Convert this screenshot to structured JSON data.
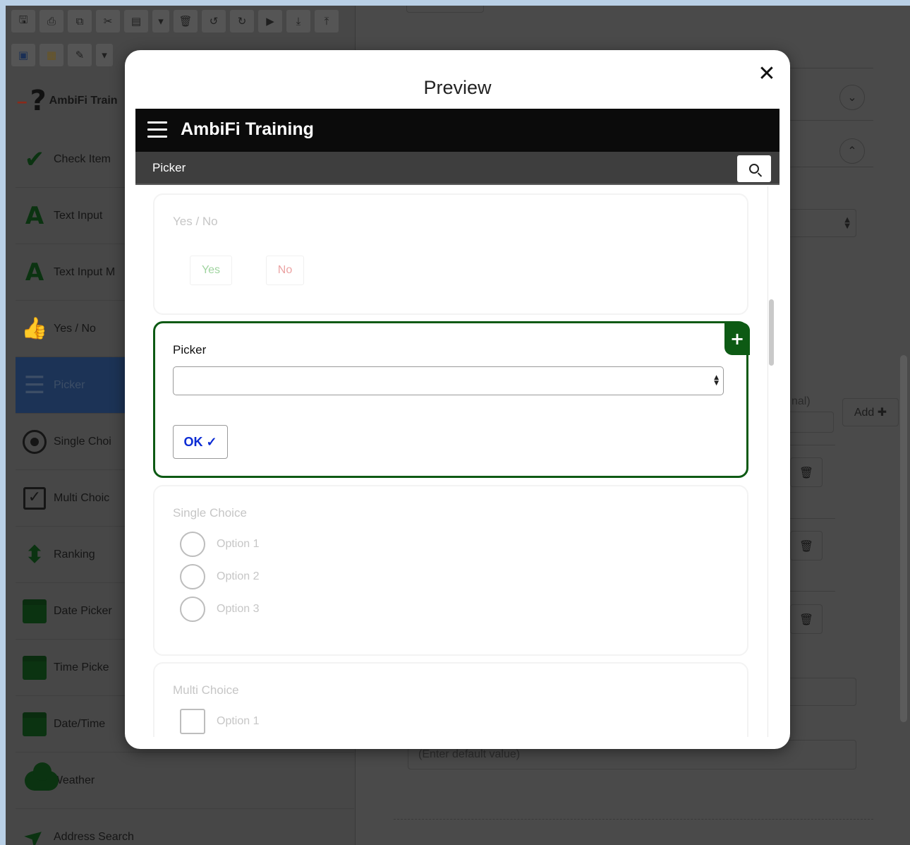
{
  "editor": {
    "toolbar_row1": [
      {
        "icon": "save-icon",
        "glyph": "🖫"
      },
      {
        "icon": "print-icon",
        "glyph": "⎙"
      },
      {
        "icon": "copy-icon",
        "glyph": "⧉"
      },
      {
        "icon": "cut-icon",
        "glyph": "✂"
      },
      {
        "icon": "paste-icon",
        "glyph": "▤"
      },
      {
        "icon": "dropdown-caret-icon",
        "glyph": "▾"
      },
      {
        "icon": "trash-icon",
        "glyph": "🗑"
      },
      {
        "icon": "undo-icon",
        "glyph": "↺"
      },
      {
        "icon": "redo-icon",
        "glyph": "↻"
      },
      {
        "icon": "play-icon",
        "glyph": "▶"
      },
      {
        "icon": "download-icon",
        "glyph": "⤓"
      },
      {
        "icon": "upload-icon",
        "glyph": "⤒"
      }
    ],
    "toolbar_row2": [
      {
        "icon": "layout-icon",
        "glyph": "▣"
      },
      {
        "icon": "grid-icon",
        "glyph": "▦"
      },
      {
        "icon": "edit-icon",
        "glyph": "✎"
      },
      {
        "icon": "dropdown-caret-icon",
        "glyph": "▾"
      }
    ],
    "tree_root_label": "AmbiFi Train",
    "controls": [
      {
        "name": "check-item",
        "label": "Check Item",
        "icon": "checkmark-icon",
        "glyph": "✔"
      },
      {
        "name": "text-input",
        "label": "Text Input",
        "icon": "letter-a-icon",
        "glyph": "A"
      },
      {
        "name": "text-input-multi",
        "label": "Text Input M",
        "icon": "letter-a-icon",
        "glyph": "A"
      },
      {
        "name": "yes-no",
        "label": "Yes / No",
        "icon": "thumbs-up-icon",
        "glyph": "👍"
      },
      {
        "name": "picker",
        "label": "Picker",
        "icon": "list-icon",
        "glyph": "☰"
      },
      {
        "name": "single-choice",
        "label": "Single Choi",
        "icon": "radio-icon",
        "glyph": ""
      },
      {
        "name": "multi-choice",
        "label": "Multi Choic",
        "icon": "checkbox-icon",
        "glyph": "✓"
      },
      {
        "name": "ranking",
        "label": "Ranking",
        "icon": "up-down-arrows-icon",
        "glyph": "⬍"
      },
      {
        "name": "date-picker",
        "label": "Date Picker",
        "icon": "calendar-icon",
        "glyph": ""
      },
      {
        "name": "time-picker",
        "label": "Time Picke",
        "icon": "calendar-icon",
        "glyph": ""
      },
      {
        "name": "date-time",
        "label": "Date/Time",
        "icon": "calendar-icon",
        "glyph": ""
      },
      {
        "name": "weather",
        "label": "Weather",
        "icon": "cloud-icon",
        "glyph": ""
      },
      {
        "name": "address-search",
        "label": "Address Search",
        "icon": "location-arrow-icon",
        "glyph": "➤"
      }
    ],
    "right": {
      "optional_label_fragment": "nal)",
      "add_button": "Add ✚",
      "default_value_placeholder": "(Enter default value)",
      "chevron_down": "⌄",
      "chevron_up": "⌃",
      "trash_glyph": "🗑"
    }
  },
  "modal": {
    "title": "Preview",
    "close_glyph": "✕",
    "app_title": "AmbiFi Training",
    "sub_title": "Picker",
    "cards": {
      "yes_no": {
        "label": "Yes / No",
        "yes": "Yes",
        "no": "No"
      },
      "picker": {
        "label": "Picker",
        "plus": "+",
        "select_value": "",
        "ok": "OK ✓"
      },
      "single_choice": {
        "label": "Single Choice",
        "options": [
          "Option 1",
          "Option 2",
          "Option 3"
        ]
      },
      "multi_choice": {
        "label": "Multi Choice",
        "options": [
          "Option 1"
        ]
      }
    }
  },
  "colors": {
    "accent_green": "#0d5a14",
    "ok_blue": "#0b2bd4",
    "selected_bg": "#1c3356"
  }
}
